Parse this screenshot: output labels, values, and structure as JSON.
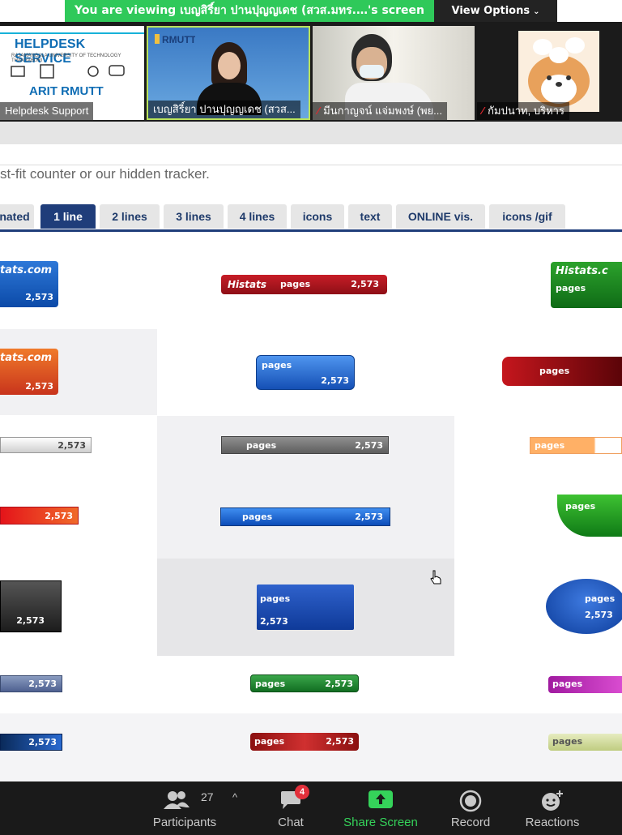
{
  "banner": {
    "text": "You are viewing เบญสิริ์ยา ปานปุญญเดช (สวส.มทร.…'s screen",
    "view_options": "View Options"
  },
  "participants_gallery": [
    {
      "name": "Helpdesk Support",
      "muted": false,
      "logo_title": "HELPDESK SERVICE",
      "logo_subtitle": "RAJAMANGALA UNIVERSITY OF TECHNOLOGY THANYABURI",
      "logo_footer": "ARIT RMUTT"
    },
    {
      "name": "เบญสิริ์ยา ปานปุญญเดช (สวส...",
      "muted": false,
      "logo": "RMUTT"
    },
    {
      "name": "มีนกาญจน์ แจ่มพงษ์ (พย...",
      "muted": true
    },
    {
      "name": "กัมปนาท, บริหาร",
      "muted": true
    }
  ],
  "page": {
    "intro_text": "st-fit counter or our hidden tracker.",
    "tabs": [
      {
        "label": "nated",
        "active": false
      },
      {
        "label": "1 line",
        "active": true
      },
      {
        "label": "2 lines",
        "active": false
      },
      {
        "label": "3 lines",
        "active": false
      },
      {
        "label": "4 lines",
        "active": false
      },
      {
        "label": "icons",
        "active": false
      },
      {
        "label": "text",
        "active": false
      },
      {
        "label": "ONLINE vis.",
        "active": false
      },
      {
        "label": "icons /gif",
        "active": false
      }
    ],
    "counter_value": "2,573",
    "counter_label": "pages",
    "brand_text": "Histats",
    "brand_text_com": "tats.com",
    "brand_text_partial": "Histats.c"
  },
  "toolbar": {
    "participants": {
      "label": "Participants",
      "count": "27"
    },
    "chat": {
      "label": "Chat",
      "badge": "4"
    },
    "share": {
      "label": "Share Screen"
    },
    "record": {
      "label": "Record"
    },
    "reactions": {
      "label": "Reactions"
    }
  },
  "colors": {
    "zoom_green": "#2fc95a",
    "tab_active": "#1f3d7a",
    "badge_red": "#e3303b"
  }
}
